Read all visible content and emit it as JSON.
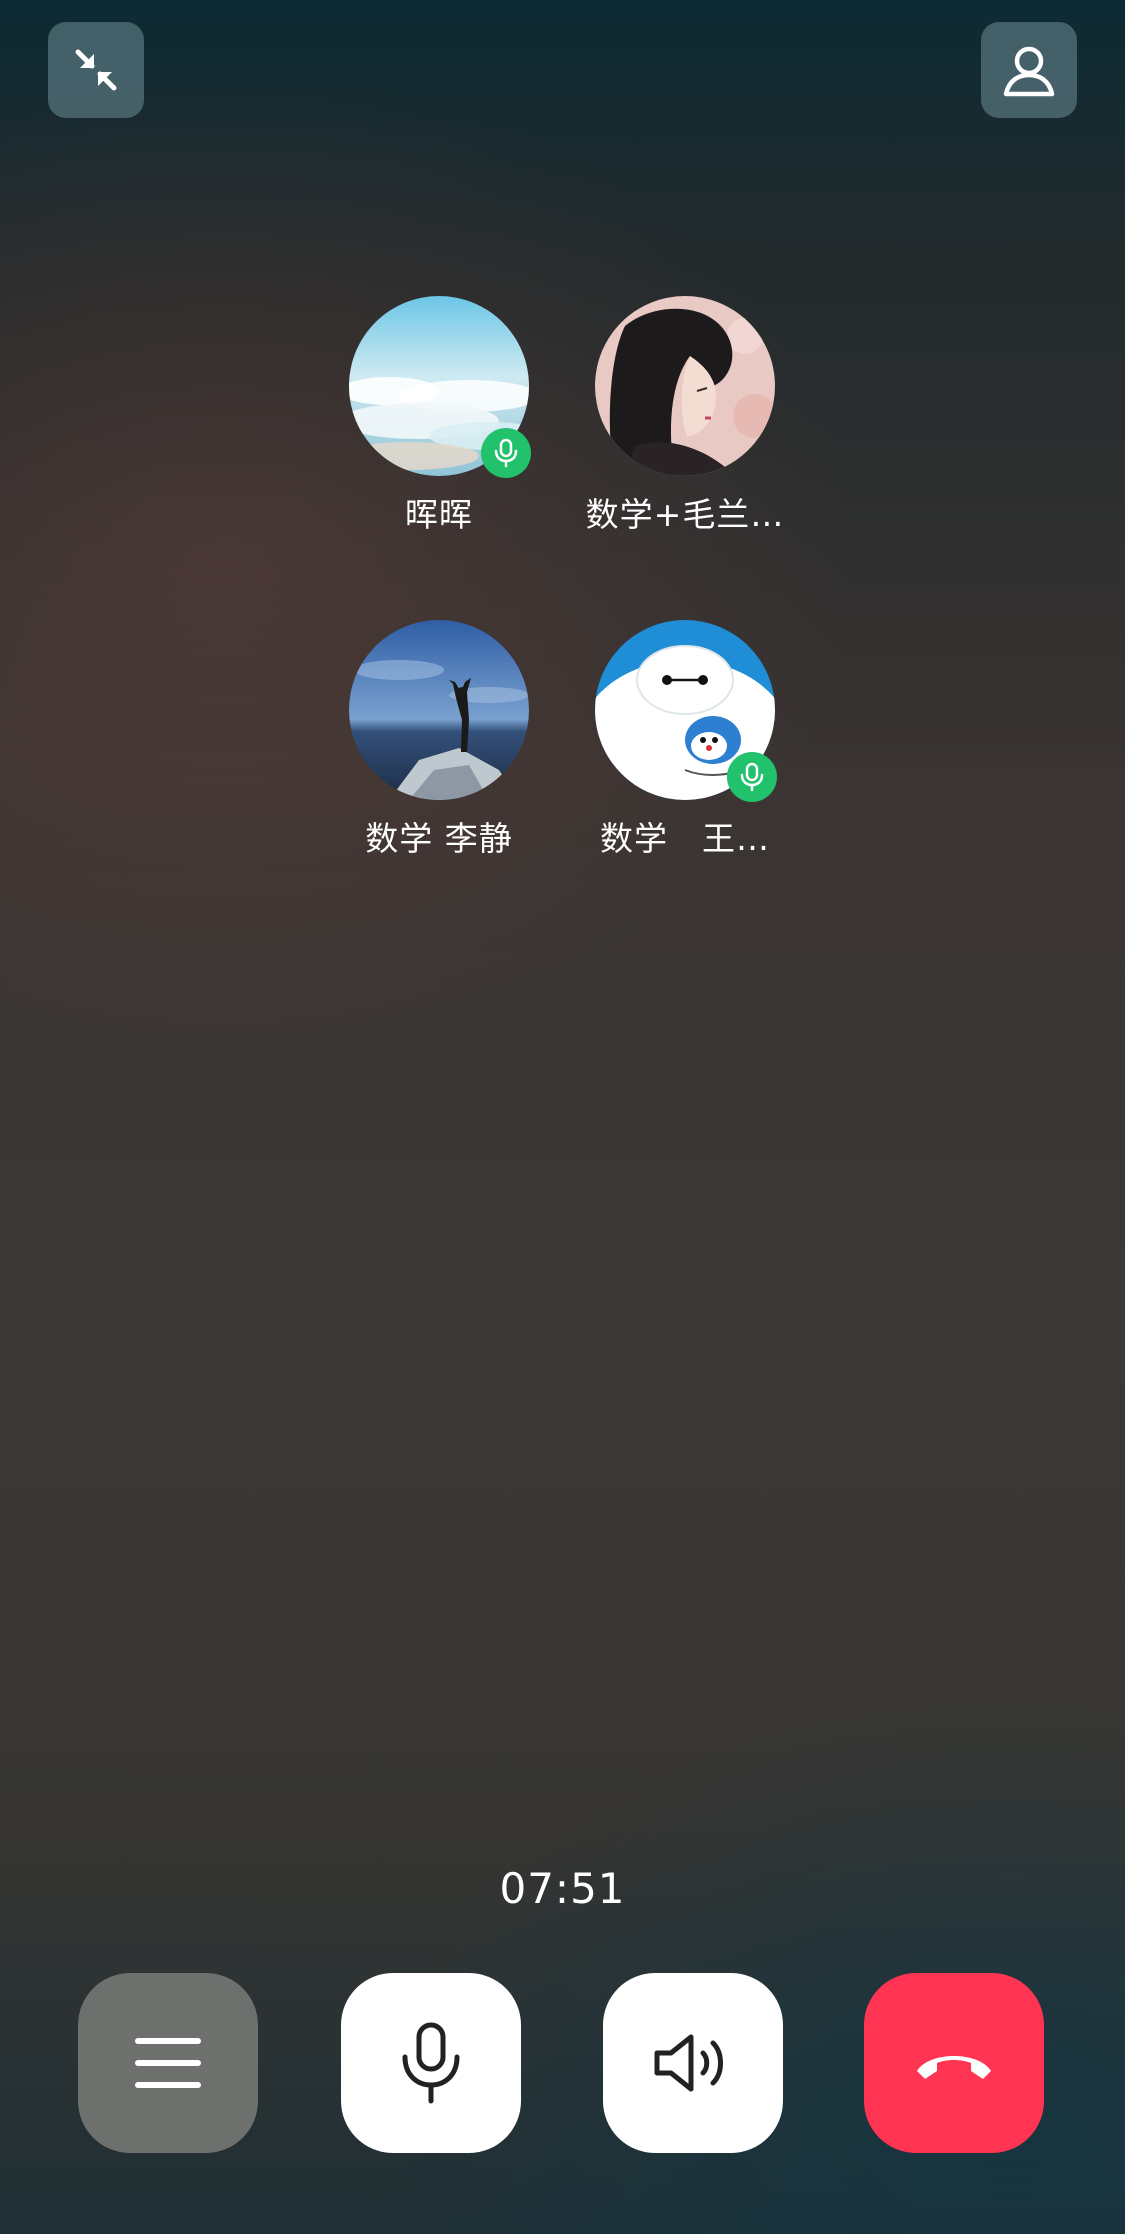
{
  "top_bar": {
    "minimize_icon": "minimize-arrows-icon",
    "add_member_icon": "person-icon"
  },
  "participants": [
    {
      "name": "晖晖",
      "speaking": true,
      "avatar": "clouds-sky"
    },
    {
      "name": "数学+毛兰…",
      "speaking": false,
      "avatar": "illustrated-woman"
    },
    {
      "name": "数学 李静",
      "speaking": false,
      "avatar": "person-on-rock-by-sea"
    },
    {
      "name": "数学　王…",
      "speaking": true,
      "avatar": "white-robot-cartoon"
    }
  ],
  "call": {
    "duration": "07:51"
  },
  "controls": {
    "menu_icon": "hamburger-menu-icon",
    "mic_icon": "microphone-icon",
    "speaker_icon": "speaker-icon",
    "hangup_icon": "hang-up-phone-icon",
    "hangup_color": "#ff3352",
    "speaking_badge_color": "#22c16b"
  }
}
